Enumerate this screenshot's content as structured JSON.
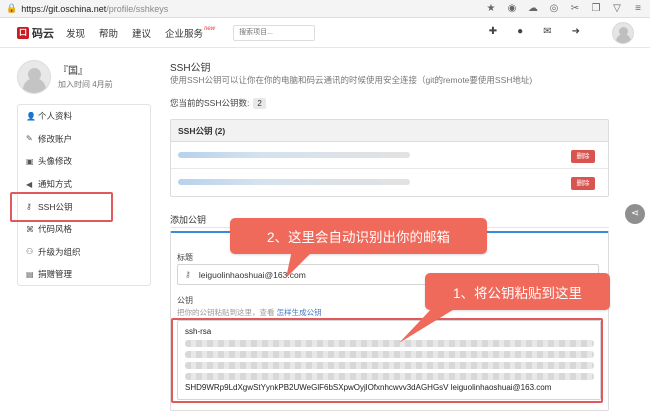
{
  "browser": {
    "url_host": "https://git.oschina.net",
    "url_path": "/profile/sshkeys"
  },
  "header": {
    "logo_text": "码云",
    "nav": [
      {
        "label": "发现"
      },
      {
        "label": "帮助"
      },
      {
        "label": "建议"
      },
      {
        "label": "企业服务",
        "badge": "new"
      }
    ],
    "search_placeholder": "搜索项目..."
  },
  "profile": {
    "name": "『国』",
    "joined": "加入时间 4月前"
  },
  "sidebar": {
    "items": [
      {
        "label": "个人资料",
        "icon": "user-icon"
      },
      {
        "label": "修改账户",
        "icon": "pencil-icon"
      },
      {
        "label": "头像修改",
        "icon": "image-icon"
      },
      {
        "label": "通知方式",
        "icon": "megaphone-icon"
      },
      {
        "label": "SSH公钥",
        "icon": "key-icon",
        "active": true
      },
      {
        "label": "代码风格",
        "icon": "code-icon"
      },
      {
        "label": "升级为组织",
        "icon": "users-icon"
      },
      {
        "label": "捐赠管理",
        "icon": "gift-icon"
      }
    ]
  },
  "main": {
    "title": "SSH公钥",
    "description": "使用SSH公钥可以让你在你的电脑和码云通讯的时候使用安全连接（git的remote要使用SSH地址)",
    "count_label": "您当前的SSH公钥数:",
    "count_value": "2",
    "keys_panel_title": "SSH公钥 (2)",
    "delete_label": "删除",
    "add_title": "添加公钥",
    "form": {
      "title_label": "标题",
      "title_value": "leiguolinhaoshuai@163.com",
      "key_label": "公钥",
      "key_hint": "把你的公钥粘贴到这里，查看",
      "key_hint_link": "怎样生成公钥",
      "key_first_line": "ssh-rsa",
      "key_last_line": "SHD9WRp9LdXgwStYynkPB2UWeGlF6bSXpwOyjlOfxnhcwvv3dAGHGsV leiguolinhaoshuai@163.com"
    }
  },
  "annotations": {
    "callout_2": "2、这里会自动识别出你的邮箱",
    "callout_1": "1、将公钥粘贴到这里"
  },
  "colors": {
    "brand": "#c71d23",
    "callout": "#f06a5b",
    "highlight_border": "#e0595c",
    "delete_button": "#d9534f",
    "link": "#4078c0"
  }
}
